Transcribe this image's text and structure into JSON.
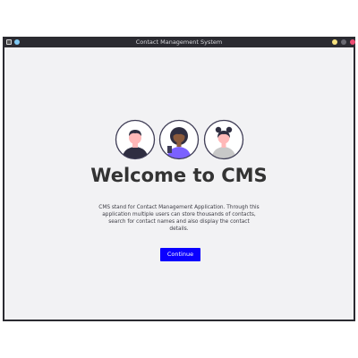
{
  "window": {
    "title": "Contact Management System"
  },
  "welcome": {
    "heading": "Welcome to CMS",
    "description": "CMS stand for Contact Management Application. Through this application multiple users can store thousands of contacts, search for contact names and also display the contact details.",
    "continue_label": "Continue"
  },
  "icons": {
    "app": "app-icon",
    "window_controls": [
      "minimize-icon",
      "maximize-icon",
      "close-icon"
    ],
    "avatars": [
      "man-avatar-icon",
      "woman-avatar-icon",
      "girl-avatar-icon"
    ]
  },
  "colors": {
    "titlebar": "#2b2b31",
    "background": "#f2f2f4",
    "heading": "#333333",
    "button": "#0b00ff",
    "minimize": "#f6e27f",
    "maximize": "#6a6a72",
    "close": "#ee4d73"
  }
}
